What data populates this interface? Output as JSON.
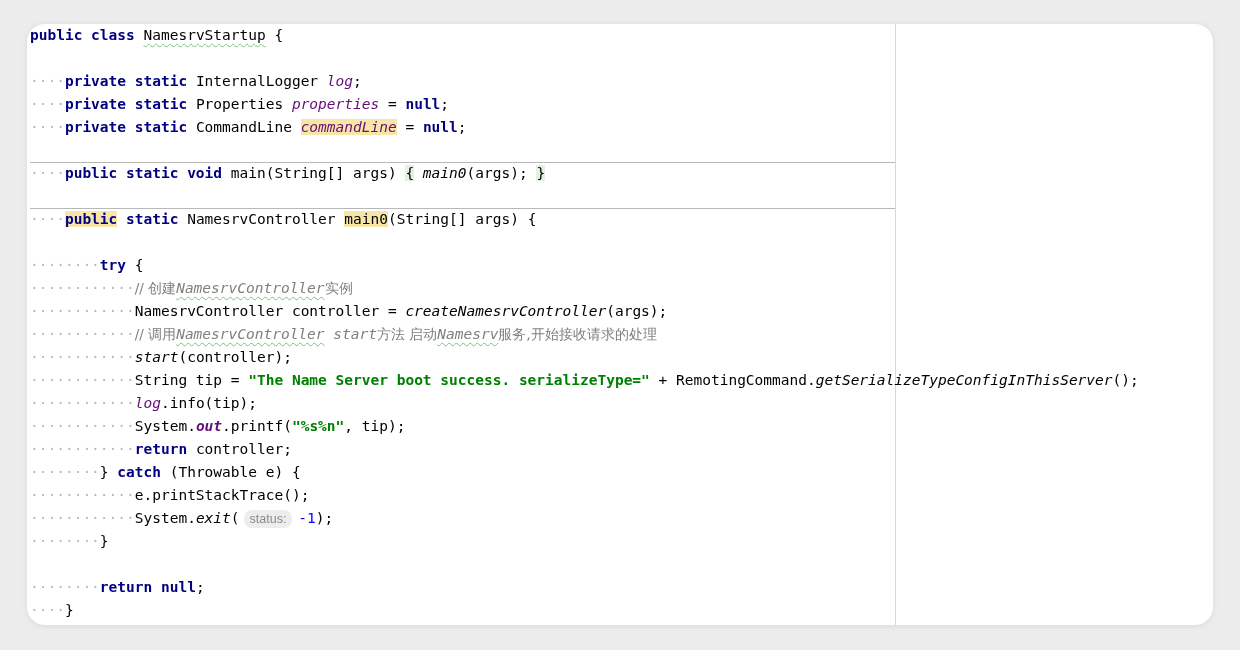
{
  "editor": {
    "lines": [
      {
        "separator_above": false,
        "tokens": [
          {
            "t": "public class ",
            "kind": "keyword"
          },
          {
            "t": "NamesrvStartup",
            "kind": "plain",
            "typo": true
          },
          {
            "t": " {",
            "kind": "plain"
          }
        ]
      },
      {
        "separator_above": false
      },
      {
        "separator_above": false,
        "indent": "····",
        "tokens": [
          {
            "t": "private static ",
            "kind": "keyword"
          },
          {
            "t": "InternalLogger ",
            "kind": "plain"
          },
          {
            "t": "log",
            "kind": "field"
          },
          {
            "t": ";",
            "kind": "plain"
          }
        ]
      },
      {
        "separator_above": false,
        "indent": "····",
        "tokens": [
          {
            "t": "private static ",
            "kind": "keyword"
          },
          {
            "t": "Properties ",
            "kind": "plain"
          },
          {
            "t": "properties",
            "kind": "field"
          },
          {
            "t": " = ",
            "kind": "plain"
          },
          {
            "t": "null",
            "kind": "keyword"
          },
          {
            "t": ";",
            "kind": "plain"
          }
        ]
      },
      {
        "separator_above": false,
        "indent": "····",
        "tokens": [
          {
            "t": "private static ",
            "kind": "keyword"
          },
          {
            "t": "CommandLine ",
            "kind": "plain"
          },
          {
            "t": "commandLine",
            "kind": "field",
            "highlight": true
          },
          {
            "t": " = ",
            "kind": "plain"
          },
          {
            "t": "null",
            "kind": "keyword"
          },
          {
            "t": ";",
            "kind": "plain"
          }
        ]
      },
      {
        "separator_above": false
      },
      {
        "separator_above": true,
        "indent": "····",
        "tokens": [
          {
            "t": "public static void ",
            "kind": "keyword"
          },
          {
            "t": "main(String[] args) ",
            "kind": "plain"
          },
          {
            "t": "{",
            "kind": "plain",
            "fold": true
          },
          {
            "t": " main0",
            "kind": "call"
          },
          {
            "t": "(args); ",
            "kind": "plain"
          },
          {
            "t": "}",
            "kind": "plain",
            "fold": true
          }
        ]
      },
      {
        "separator_above": false
      },
      {
        "separator_above": true,
        "indent": "····",
        "tokens": [
          {
            "t": "public",
            "kind": "keyword",
            "highlight": true
          },
          {
            "t": " static ",
            "kind": "keyword"
          },
          {
            "t": "NamesrvController ",
            "kind": "plain"
          },
          {
            "t": "main0",
            "kind": "plain",
            "highlight": true
          },
          {
            "t": "(String[] args) {",
            "kind": "plain"
          }
        ]
      },
      {
        "separator_above": false
      },
      {
        "separator_above": false,
        "indent": "········",
        "tokens": [
          {
            "t": "try",
            "kind": "keyword"
          },
          {
            "t": " {",
            "kind": "plain"
          }
        ]
      },
      {
        "separator_above": false,
        "indent": "············",
        "tokens": [
          {
            "t": "// 创建",
            "kind": "comment"
          },
          {
            "t": "NamesrvController",
            "kind": "comment-ref",
            "typo": true
          },
          {
            "t": "实例",
            "kind": "comment"
          }
        ]
      },
      {
        "separator_above": false,
        "indent": "············",
        "tokens": [
          {
            "t": "NamesrvController controller = ",
            "kind": "plain"
          },
          {
            "t": "createNamesrvController",
            "kind": "call"
          },
          {
            "t": "(args);",
            "kind": "plain"
          }
        ]
      },
      {
        "separator_above": false,
        "indent": "············",
        "tokens": [
          {
            "t": "// 调用",
            "kind": "comment"
          },
          {
            "t": "NamesrvController",
            "kind": "comment-ref",
            "typo": true
          },
          {
            "t": " start",
            "kind": "comment-ref"
          },
          {
            "t": "方法 启动",
            "kind": "comment"
          },
          {
            "t": "Namesrv",
            "kind": "comment-ref",
            "typo": true
          },
          {
            "t": "服务,开始接收请求的处理",
            "kind": "comment"
          }
        ]
      },
      {
        "separator_above": false,
        "indent": "············",
        "tokens": [
          {
            "t": "start",
            "kind": "call"
          },
          {
            "t": "(controller);",
            "kind": "plain"
          }
        ]
      },
      {
        "separator_above": false,
        "indent": "············",
        "tokens": [
          {
            "t": "String tip = ",
            "kind": "plain"
          },
          {
            "t": "\"The Name Server boot success. serializeType=\"",
            "kind": "string"
          },
          {
            "t": " + RemotingCommand.",
            "kind": "plain"
          },
          {
            "t": "getSerializeTypeConfigInThisServer",
            "kind": "call"
          },
          {
            "t": "();",
            "kind": "plain"
          }
        ]
      },
      {
        "separator_above": false,
        "indent": "············",
        "tokens": [
          {
            "t": "log",
            "kind": "field"
          },
          {
            "t": ".info(tip);",
            "kind": "plain"
          }
        ]
      },
      {
        "separator_above": false,
        "indent": "············",
        "tokens": [
          {
            "t": "System.",
            "kind": "plain"
          },
          {
            "t": "out",
            "kind": "static-field"
          },
          {
            "t": ".printf(",
            "kind": "plain"
          },
          {
            "t": "\"%s%n\"",
            "kind": "string"
          },
          {
            "t": ", tip);",
            "kind": "plain"
          }
        ]
      },
      {
        "separator_above": false,
        "indent": "············",
        "tokens": [
          {
            "t": "return",
            "kind": "keyword"
          },
          {
            "t": " controller;",
            "kind": "plain"
          }
        ]
      },
      {
        "separator_above": false,
        "indent": "········",
        "tokens": [
          {
            "t": "} ",
            "kind": "plain"
          },
          {
            "t": "catch",
            "kind": "keyword"
          },
          {
            "t": " (Throwable e) {",
            "kind": "plain"
          }
        ]
      },
      {
        "separator_above": false,
        "indent": "············",
        "tokens": [
          {
            "t": "e.printStackTrace();",
            "kind": "plain"
          }
        ]
      },
      {
        "separator_above": false,
        "indent": "············",
        "tokens": [
          {
            "t": "System.",
            "kind": "plain"
          },
          {
            "t": "exit",
            "kind": "call"
          },
          {
            "t": "(",
            "kind": "plain"
          },
          {
            "t": "status:",
            "kind": "hint"
          },
          {
            "t": "-1",
            "kind": "number"
          },
          {
            "t": ");",
            "kind": "plain"
          }
        ]
      },
      {
        "separator_above": false,
        "indent": "········",
        "tokens": [
          {
            "t": "}",
            "kind": "plain"
          }
        ]
      },
      {
        "separator_above": false
      },
      {
        "separator_above": false,
        "indent": "········",
        "tokens": [
          {
            "t": "return null",
            "kind": "keyword"
          },
          {
            "t": ";",
            "kind": "plain"
          }
        ]
      },
      {
        "separator_above": false,
        "indent": "····",
        "tokens": [
          {
            "t": "}",
            "kind": "plain"
          }
        ]
      }
    ]
  }
}
